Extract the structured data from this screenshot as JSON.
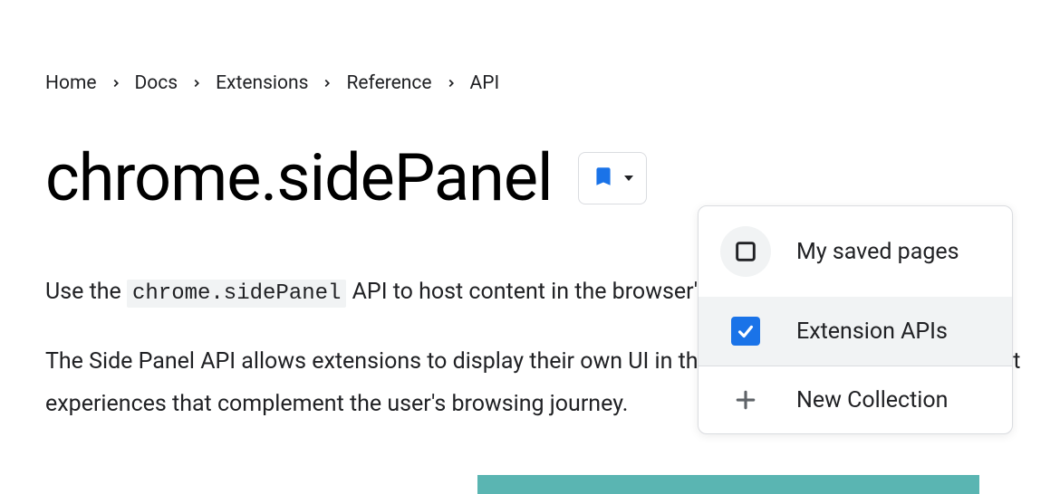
{
  "breadcrumb": {
    "items": [
      "Home",
      "Docs",
      "Extensions",
      "Reference",
      "API"
    ]
  },
  "page": {
    "title": "chrome.sidePanel",
    "intro_prefix": "Use the ",
    "intro_code": "chrome.sidePanel",
    "intro_suffix": " API to host content in the browser's side panel alongside the",
    "para2": "The Side Panel API allows extensions to display their own UI in the side panel, enabling persistent experiences that complement the user's browsing journey."
  },
  "dropdown": {
    "items": [
      {
        "label": "My saved pages"
      },
      {
        "label": "Extension APIs"
      },
      {
        "label": "New Collection"
      }
    ]
  }
}
